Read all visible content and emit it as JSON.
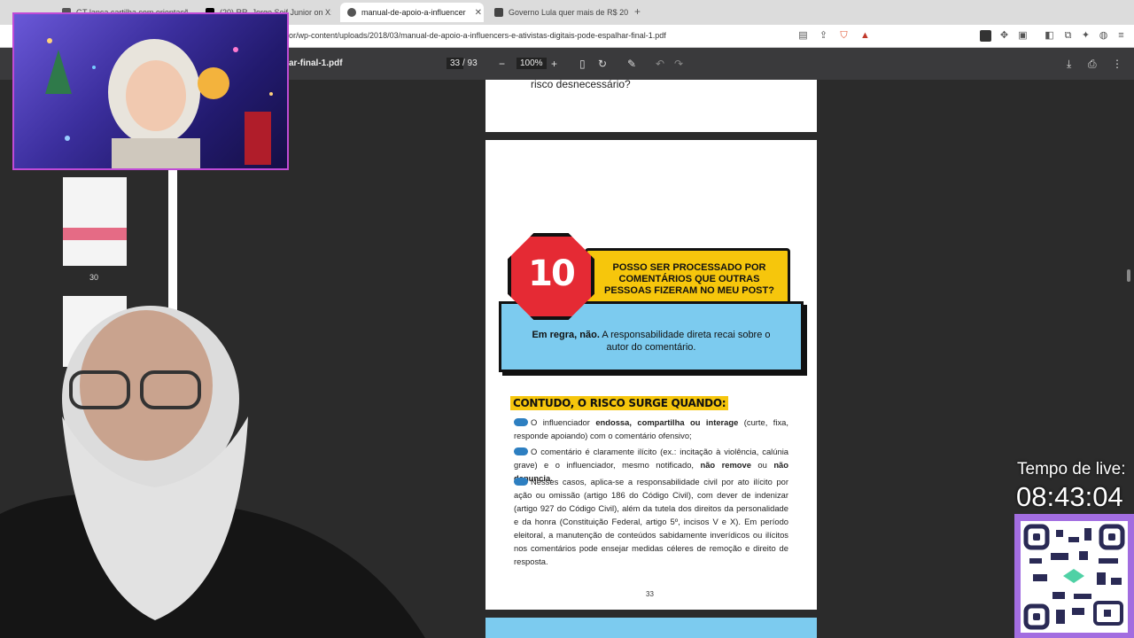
{
  "browser": {
    "tabs": [
      {
        "title": "GT lança cartilha com orientaçõe",
        "favicon_color": "#555555"
      },
      {
        "title": "(20) RR. Jorge Seif Junior on X: \"",
        "favicon_color": "#000000"
      },
      {
        "title": "manual-de-apoio-a-influencer",
        "favicon_color": "#555555",
        "active": true
      },
      {
        "title": "Governo Lula quer mais de R$ 20",
        "favicon_color": "#444444"
      }
    ],
    "url": "or/wp-content/uploads/2018/03/manual-de-apoio-a-influencers-e-ativistas-digitais-pode-espalhar-final-1.pdf"
  },
  "pdf_toolbar": {
    "filename": "ar-final-1.pdf",
    "current_page": "33",
    "total_pages": "/ 93",
    "zoom": "100%"
  },
  "sidebar": {
    "thumbnail_label": "30"
  },
  "document": {
    "prev_page_text": "risco desnecessário?",
    "badge_number": "10",
    "question": "POSSO SER PROCESSADO POR COMENTÁRIOS QUE OUTRAS PESSOAS FIZERAM NO MEU POST?",
    "answer_bold": "Em regra, não.",
    "answer_rest": " A responsabilidade direta recai sobre o autor do comentário.",
    "risk_heading": "CONTUDO, O RISCO SURGE QUANDO:",
    "p1_a": "O influenciador ",
    "p1_b": "endossa, compartilha ou interage",
    "p1_c": " (curte, fixa, responde apoiando) com o comentário ofensivo;",
    "p2_a": "O comentário é claramente ilícito (ex.: incitação à violência, calúnia grave) e o influenciador, mesmo notificado, ",
    "p2_b": "não remove",
    "p2_c": " ou ",
    "p2_d": "não denuncia.",
    "p3": "Nesses casos, aplica-se a responsabilidade civil por ato ilícito por ação ou omissão (artigo 186 do Código Civil), com dever de indenizar (artigo 927 do Código Civil), além da tutela dos direitos da personalidade e da honra (Constituição Federal, artigo 5º, incisos V e X). Em período eleitoral, a manutenção de conteúdos sabidamente inverídicos ou ilícitos nos comentários pode ensejar medidas céleres de remoção e direito de resposta.",
    "page_number": "33"
  },
  "overlay": {
    "timer_label": "Tempo de live:",
    "timer_value": "08:43:04"
  }
}
